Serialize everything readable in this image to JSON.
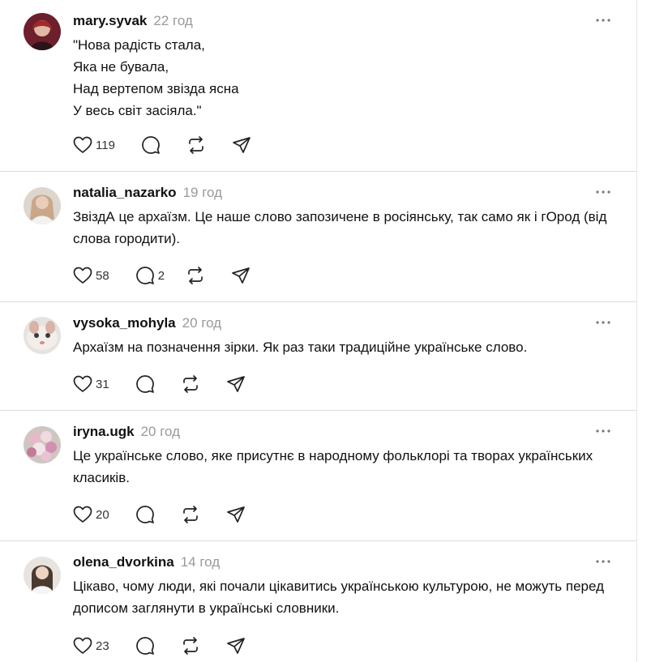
{
  "posts": [
    {
      "username": "mary.syvak",
      "time": "22 год",
      "text": "\"Нова радість стала,\nЯка не бувала,\nНад вертепом звізда ясна\nУ весь світ засіяла.\"",
      "likes": "119",
      "replies": "",
      "avatar_color": "#8a2a3a"
    },
    {
      "username": "natalia_nazarko",
      "time": "19 год",
      "text": "ЗвіздА це архаїзм. Це наше слово запозичене в росіянську, так само як і гОрод (від слова городити).",
      "likes": "58",
      "replies": "2",
      "avatar_color": "#c9b8a8"
    },
    {
      "username": "vysoka_mohyla",
      "time": "20 год",
      "text": "Архаїзм на позначення зірки. Як раз таки традиційне українське слово.",
      "likes": "31",
      "replies": "",
      "avatar_color": "#d8cfc9"
    },
    {
      "username": "iryna.ugk",
      "time": "20 год",
      "text": "Це українське слово, яке присутнє в народному фольклорі та творах українських класиків.",
      "likes": "20",
      "replies": "",
      "avatar_color": "#b98fa8"
    },
    {
      "username": "olena_dvorkina",
      "time": "14 год",
      "text": "Цікаво, чому люди, які почали цікавитись українською культурою, не можуть перед дописом заглянути в українські словники.",
      "likes": "23",
      "replies": "",
      "avatar_color": "#9c8a7c"
    }
  ],
  "icons": {
    "like": "heart-icon",
    "reply": "comment-icon",
    "repost": "repost-icon",
    "share": "send-icon",
    "more": "more-icon"
  }
}
